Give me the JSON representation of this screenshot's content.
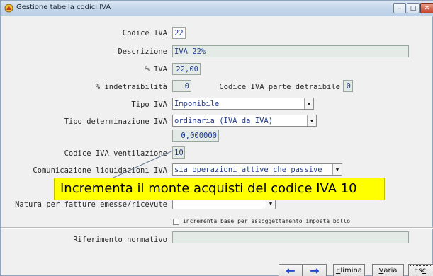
{
  "window": {
    "title": "Gestione tabella codici IVA",
    "min_glyph": "–",
    "max_glyph": "□",
    "close_glyph": "✕"
  },
  "form": {
    "codice_iva": {
      "label": "Codice IVA",
      "value": "22"
    },
    "descrizione": {
      "label": "Descrizione",
      "value": "IVA 22%"
    },
    "percent_iva": {
      "label": "% IVA",
      "value": "22,00"
    },
    "indetraibilita": {
      "label": "% indetraibilità",
      "value": "0"
    },
    "codice_detraibile": {
      "label": "Codice IVA parte detraibile",
      "value": "0"
    },
    "tipo_iva": {
      "label": "Tipo IVA",
      "value": "Imponibile"
    },
    "tipo_determinazione": {
      "label": "Tipo determinazione IVA",
      "value": "ordinaria (IVA da IVA)"
    },
    "coefficiente": {
      "value": "0,000000"
    },
    "ventilazione": {
      "label": "Codice IVA ventilazione",
      "value": "10"
    },
    "comunicazione": {
      "label": "Comunicazione liquidazioni IVA",
      "value": "sia operazioni attive che passive"
    },
    "natura": {
      "label": "Natura per fatture emesse/ricevute",
      "value": ""
    },
    "bollo": {
      "label": "incrementa base per assoggettamento imposta bollo",
      "checked": false
    },
    "riferimento": {
      "label": "Riferimento normativo",
      "value": ""
    }
  },
  "callout": {
    "text": "Incrementa il monte acquisti del codice IVA 10"
  },
  "buttons": {
    "prev_glyph": "←",
    "next_glyph": "→",
    "elimina": {
      "first": "E",
      "rest": "limina"
    },
    "varia": {
      "first": "V",
      "rest": "aria"
    },
    "esci": {
      "pre": "Es",
      "first": "c",
      "rest": "i"
    }
  }
}
